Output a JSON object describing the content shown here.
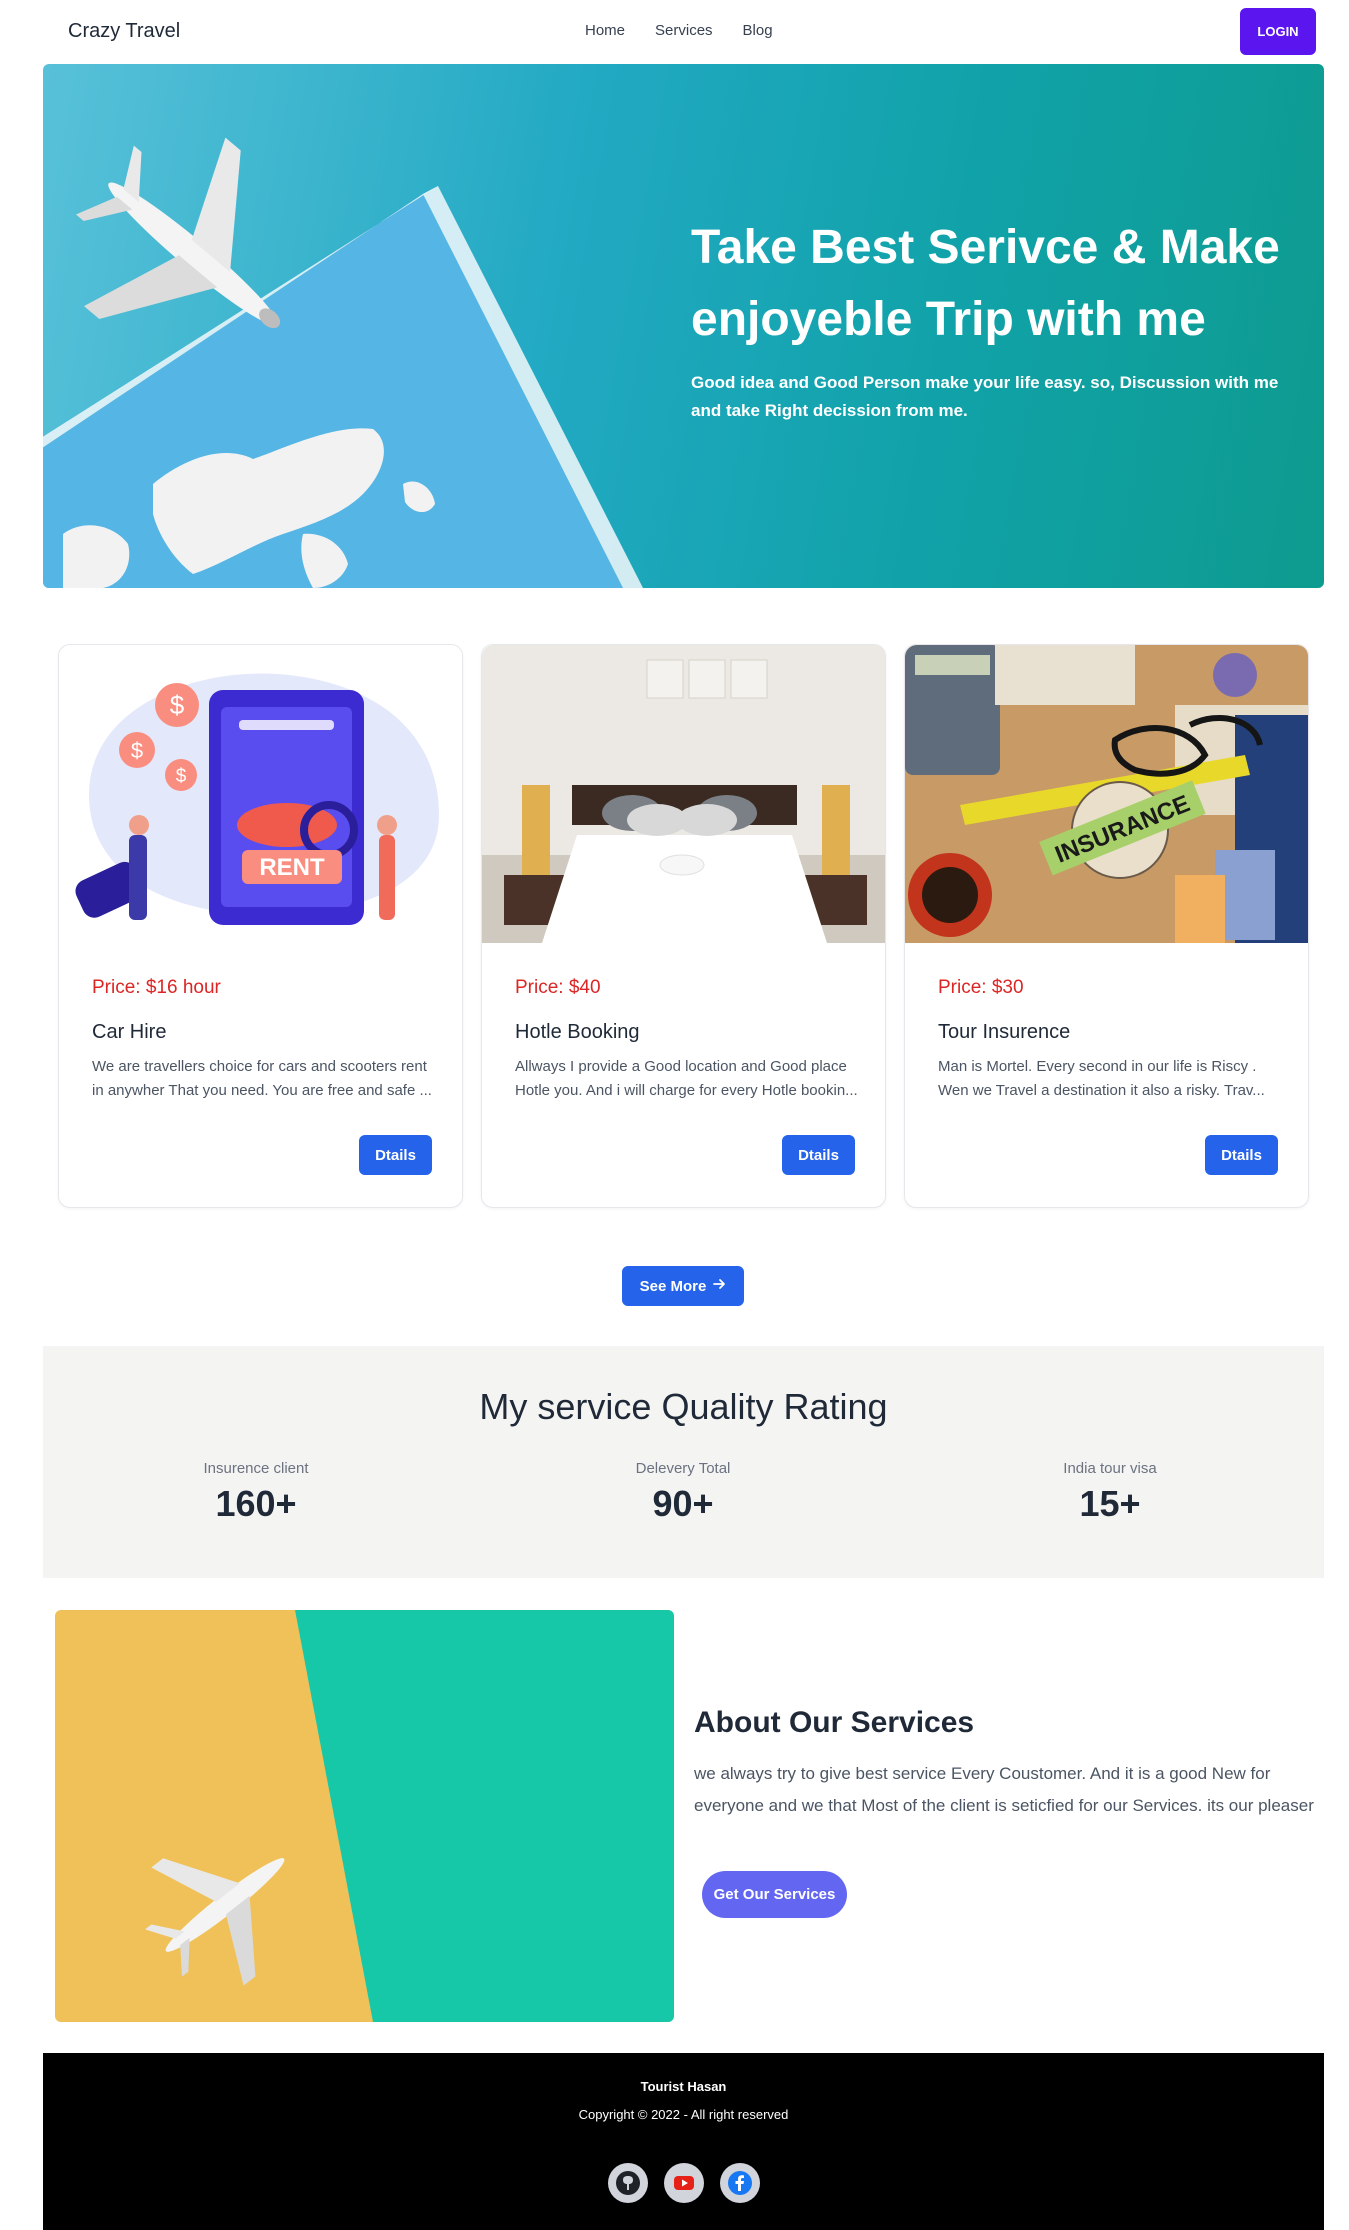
{
  "nav": {
    "brand": "Crazy Travel",
    "links": [
      "Home",
      "Services",
      "Blog"
    ],
    "login_label": "LOGIN"
  },
  "hero": {
    "title": "Take Best Serivce & Make enjoyeble Trip with me",
    "subtitle": "Good idea and Good Person make your life easy. so, Discussion with me and take Right decission from me."
  },
  "services": [
    {
      "price": "Price: $16 hour",
      "title": "Car Hire",
      "description": "We are travellers choice for cars and scooters rent in anywher That you need. You are free and safe ...",
      "button": "Dtails",
      "image_text": "RENT"
    },
    {
      "price": "Price: $40",
      "title": "Hotle Booking",
      "description": "Allways I provide a Good location and Good place Hotle you. And i will charge for every Hotle bookin...",
      "button": "Dtails"
    },
    {
      "price": "Price: $30",
      "title": "Tour Insurence",
      "description": "Man is Mortel. Every second in our life is Riscy . Wen we Travel a destination it also a risky. Trav...",
      "button": "Dtails",
      "image_text": "INSURANCE"
    }
  ],
  "see_more": {
    "label": "See More",
    "icon": "arrow-right-icon"
  },
  "rating": {
    "title": "My service Quality Rating",
    "stats": [
      {
        "label": "Insurence client",
        "value": "160+"
      },
      {
        "label": "Delevery Total",
        "value": "90+"
      },
      {
        "label": "India tour visa",
        "value": "15+"
      }
    ]
  },
  "about": {
    "title": "About Our Services",
    "description": "we always try to give best service Every Coustomer. And it is a good New for everyone and we that Most of the client is seticfied for our Services. its our pleaser",
    "button": "Get Our Services"
  },
  "footer": {
    "name": "Tourist Hasan",
    "copyright": "Copyright © 2022 - All right reserved",
    "socials": [
      "github-icon",
      "youtube-icon",
      "facebook-icon"
    ]
  },
  "colors": {
    "accent": "#2563eb",
    "login": "#5b16ef",
    "price": "#dc2626",
    "about_button": "#6366f1"
  }
}
